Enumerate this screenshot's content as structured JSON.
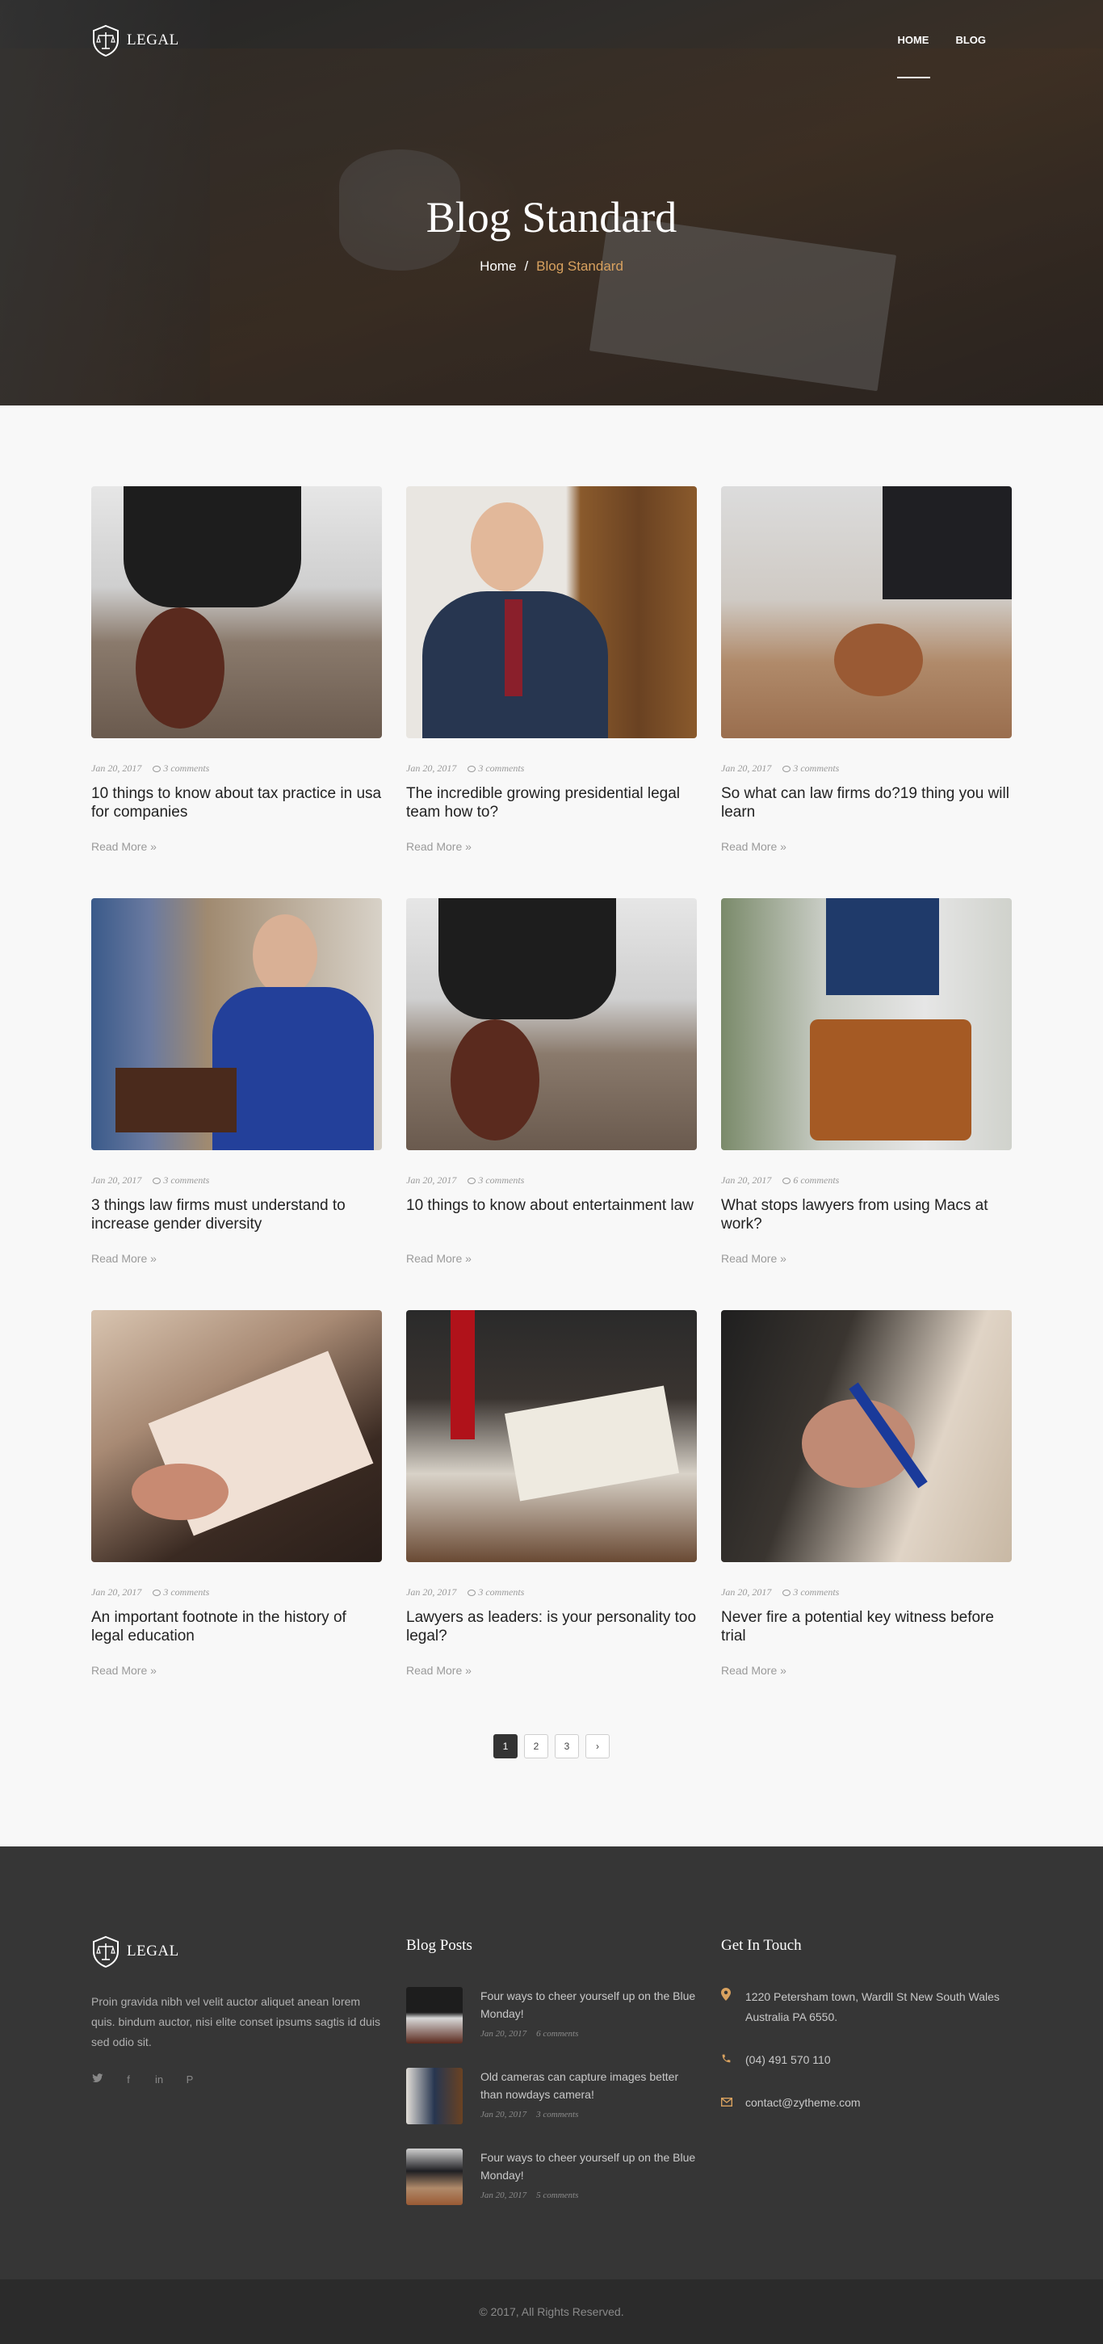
{
  "header": {
    "logo_text": "LEGAL",
    "menu": [
      {
        "label": "HOME",
        "active": true
      },
      {
        "label": "BLOG",
        "active": false
      }
    ]
  },
  "hero": {
    "title": "Blog Standard",
    "breadcrumb": {
      "home": "Home",
      "separator": "/",
      "current": "Blog Standard"
    }
  },
  "posts": [
    {
      "date": "Jan 20, 2017",
      "comments": "3 comments",
      "title": "10 things to know about tax practice in usa for companies",
      "read_more": "Read More »"
    },
    {
      "date": "Jan 20, 2017",
      "comments": "3 comments",
      "title": "The incredible growing presidential legal team how to?",
      "read_more": "Read More »"
    },
    {
      "date": "Jan 20, 2017",
      "comments": "3 comments",
      "title": "So what can law firms do?19 thing you will learn",
      "read_more": "Read More »"
    },
    {
      "date": "Jan 20, 2017",
      "comments": "3 comments",
      "title": "3 things law firms must understand to increase gender diversity",
      "read_more": "Read More »"
    },
    {
      "date": "Jan 20, 2017",
      "comments": "3 comments",
      "title": "10 things to know about entertainment law",
      "read_more": "Read More »"
    },
    {
      "date": "Jan 20, 2017",
      "comments": "6 comments",
      "title": "What stops lawyers from using Macs at work?",
      "read_more": "Read More »"
    },
    {
      "date": "Jan 20, 2017",
      "comments": "3 comments",
      "title": "An important footnote in the history of legal education",
      "read_more": "Read More »"
    },
    {
      "date": "Jan 20, 2017",
      "comments": "3 comments",
      "title": "Lawyers as leaders: is your personality too legal?",
      "read_more": "Read More »"
    },
    {
      "date": "Jan 20, 2017",
      "comments": "3 comments",
      "title": "Never fire a potential key witness before trial",
      "read_more": "Read More »"
    }
  ],
  "pagination": {
    "pages": [
      "1",
      "2",
      "3"
    ],
    "next": "›",
    "current": "1"
  },
  "footer": {
    "logo_text": "LEGAL",
    "about": "Proin gravida nibh vel velit auctor aliquet anean lorem quis. bindum auctor, nisi elite conset ipsums sagtis id duis sed odio sit.",
    "socials": [
      {
        "name": "twitter",
        "glyph": "🐦"
      },
      {
        "name": "facebook",
        "glyph": "f"
      },
      {
        "name": "linkedin",
        "glyph": "in"
      },
      {
        "name": "pinterest",
        "glyph": "P"
      }
    ],
    "blog_heading": "Blog Posts",
    "blog_posts": [
      {
        "title": "Four ways to cheer yourself up on the Blue Monday!",
        "date": "Jan 20, 2017",
        "comments": "6 comments"
      },
      {
        "title": "Old cameras can capture images better than nowdays camera!",
        "date": "Jan 20, 2017",
        "comments": "3 comments"
      },
      {
        "title": "Four ways to cheer yourself up on the Blue Monday!",
        "date": "Jan 20, 2017",
        "comments": "5 comments"
      }
    ],
    "contact_heading": "Get In Touch",
    "contact": {
      "address": "1220 Petersham town, Wardll St New South Wales Australia PA 6550.",
      "phone": "(04) 491 570 110",
      "email": "contact@zytheme.com"
    },
    "copyright": "© 2017, All Rights Reserved."
  },
  "colors": {
    "accent": "#d9a25f",
    "footer_bg": "#363636",
    "copyright_bg": "#2b2b2b",
    "page_bg": "#f8f8f8"
  }
}
